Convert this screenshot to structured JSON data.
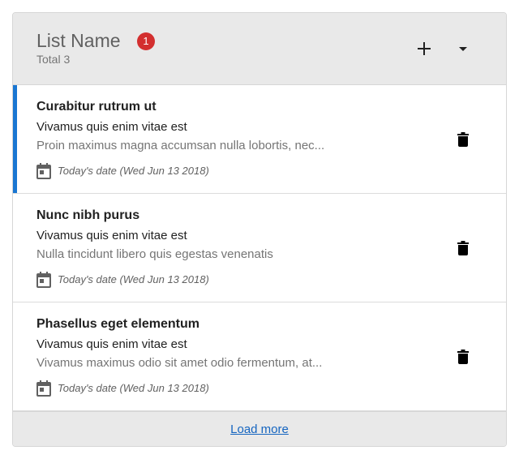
{
  "header": {
    "title": "List Name",
    "badge_count": "1",
    "subtitle": "Total 3",
    "badge_color": "#d32f2f",
    "icons": [
      "plus-icon",
      "caret-down-icon"
    ]
  },
  "accent_color": "#1976d2",
  "items": [
    {
      "title": "Curabitur rutrum ut",
      "subtitle": "Vivamus quis enim vitae est",
      "description": "Proin maximus magna accumsan nulla lobortis, nec...",
      "date": "Today's date (Wed Jun 13 2018)",
      "selected": true
    },
    {
      "title": "Nunc nibh purus",
      "subtitle": "Vivamus quis enim vitae est",
      "description": "Nulla tincidunt libero quis egestas venenatis",
      "date": "Today's date (Wed Jun 13 2018)",
      "selected": false
    },
    {
      "title": "Phasellus eget elementum",
      "subtitle": "Vivamus quis enim vitae est",
      "description": "Vivamus maximus odio sit amet odio fermentum, at...",
      "date": "Today's date (Wed Jun 13 2018)",
      "selected": false
    }
  ],
  "footer": {
    "load_more_label": "Load more"
  }
}
